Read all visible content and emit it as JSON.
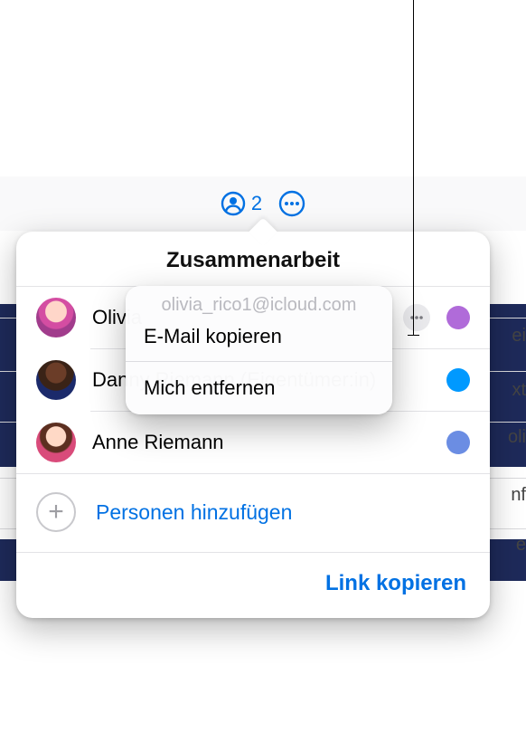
{
  "accent_color": "#0071e3",
  "toolbar": {
    "participant_count": "2"
  },
  "popover": {
    "title": "Zusammenarbeit",
    "participants": [
      {
        "name": "Olivia",
        "color": "#b06bd9"
      },
      {
        "name": "Danny Riemann (Eigentümer:in)",
        "color": "#0099ff"
      },
      {
        "name": "Anne Riemann",
        "color": "#6b8de3"
      }
    ],
    "add_label": "Personen hinzufügen",
    "copy_link_label": "Link kopieren"
  },
  "context_menu": {
    "email": "olivia_rico1@icloud.com",
    "copy_email_label": "E-Mail kopieren",
    "remove_me_label": "Mich entfernen"
  },
  "bg_fragments": {
    "a": "ei",
    "b": "xt",
    "c": "oli",
    "d": "nf",
    "e": "e"
  }
}
